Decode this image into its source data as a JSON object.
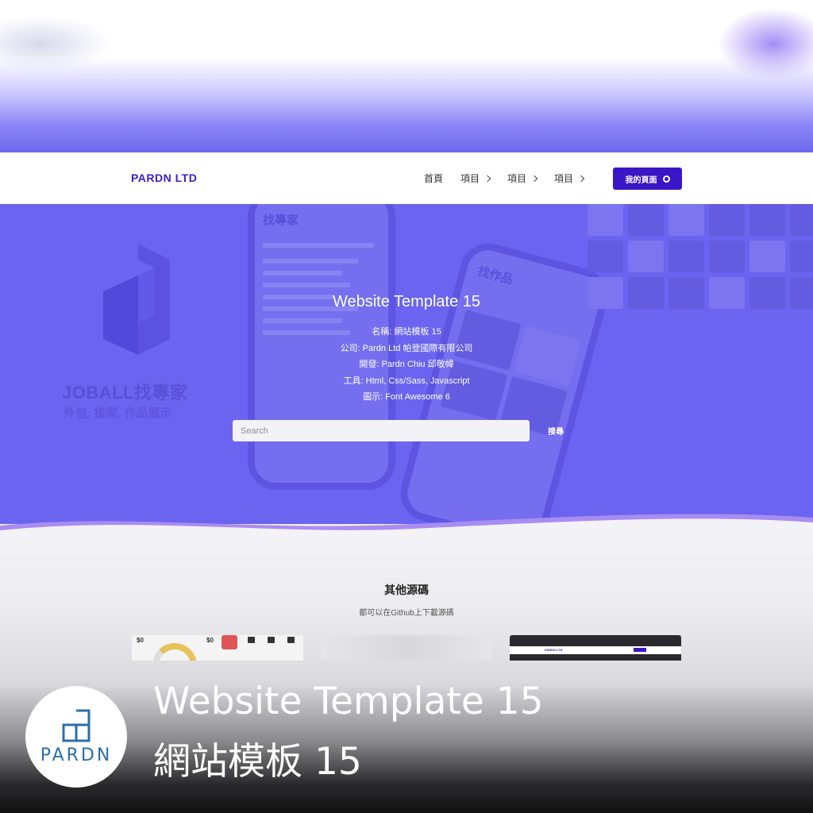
{
  "navbar": {
    "brand": "PARDN LTD",
    "links": [
      {
        "label": "首頁",
        "has_chevron": false
      },
      {
        "label": "項目",
        "has_chevron": true
      },
      {
        "label": "項目",
        "has_chevron": true
      },
      {
        "label": "項目",
        "has_chevron": true
      }
    ],
    "cta_label": "我的頁面",
    "cta_icon": "github-icon"
  },
  "hero": {
    "background_text": "JOBALL找專家",
    "background_subtext": "外包. 接案, 作品展示",
    "phone_left_title": "找專家",
    "phone_right_title": "找作品",
    "title": "Website Template 15",
    "meta": [
      "名稱: 網站模板 15",
      "公司: Pardn Ltd 帕登國際有限公司",
      "開發: Pardn Chiu 邱敬幃",
      "工具: Html, Css/Sass, Javascript",
      "圖示: Font Awesome 6"
    ],
    "search": {
      "placeholder": "Search",
      "button_label": "搜尋"
    }
  },
  "section": {
    "title": "其他源碼",
    "subtitle": "都可以在Github上下載源碼"
  },
  "cards": {
    "card1": {
      "price_left": "$0",
      "price_right": "$0"
    },
    "card3": {
      "brand": "PARDN LTD"
    }
  },
  "caption": {
    "logo_text": "PARDN",
    "title": "Website Template 15",
    "subtitle": "網站模板 15"
  },
  "colors": {
    "brand_purple": "#3a16c7",
    "hero_purple": "#6b64f0",
    "logo_blue": "#2b6fa8"
  }
}
